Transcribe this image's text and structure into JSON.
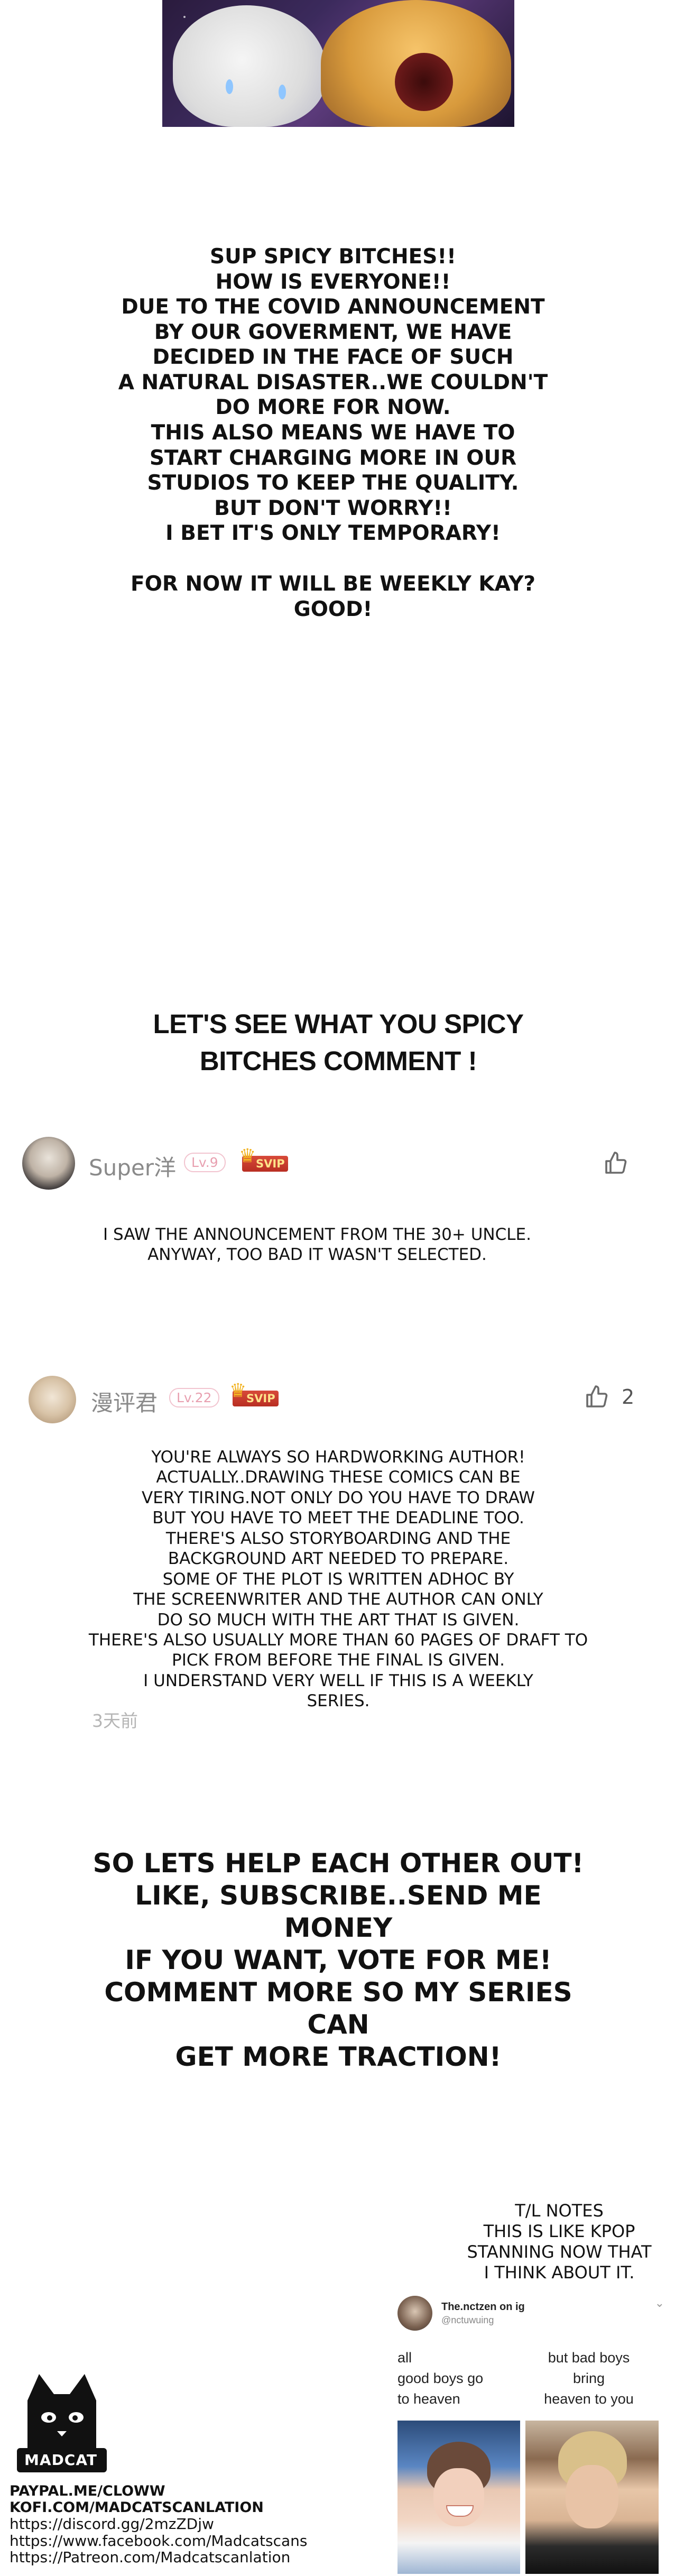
{
  "top_message": {
    "lines": [
      "SUP SPICY BITCHES!!",
      "HOW IS EVERYONE!!",
      "DUE TO THE COVID ANNOUNCEMENT",
      "BY OUR GOVERMENT, WE HAVE",
      "DECIDED IN THE FACE OF SUCH",
      "A NATURAL DISASTER..WE COULDN'T",
      "DO MORE FOR NOW.",
      "THIS ALSO MEANS WE HAVE TO",
      "START CHARGING MORE IN OUR",
      "STUDIOS TO KEEP THE QUALITY.",
      "BUT DON'T WORRY!!",
      "I BET IT'S ONLY TEMPORARY!",
      "",
      "FOR NOW IT WILL BE WEEKLY KAY?",
      "GOOD!"
    ]
  },
  "headline": {
    "line1": "LET'S SEE WHAT YOU SPICY",
    "line2": "BITCHES COMMENT !"
  },
  "comments": [
    {
      "username": "Super洋",
      "level": "Lv.9",
      "badge": "SVIP",
      "like_count": "",
      "text_lines": [
        "I SAW THE ANNOUNCEMENT FROM THE 30+ UNCLE.",
        "ANYWAY, TOO BAD IT WASN'T SELECTED."
      ],
      "date": ""
    },
    {
      "username": "漫评君",
      "level": "Lv.22",
      "badge": "SVIP",
      "like_count": "2",
      "text_lines": [
        "YOU'RE ALWAYS SO HARDWORKING AUTHOR!",
        "ACTUALLY..DRAWING THESE COMICS CAN BE",
        "VERY TIRING.NOT ONLY DO YOU HAVE TO DRAW",
        "BUT YOU HAVE TO MEET THE DEADLINE TOO.",
        "THERE'S ALSO STORYBOARDING AND THE",
        "BACKGROUND ART NEEDED TO PREPARE.",
        "SOME OF THE PLOT IS WRITTEN ADHOC BY",
        "THE SCREENWRITER AND THE AUTHOR CAN ONLY",
        "DO SO MUCH WITH THE ART THAT IS GIVEN.",
        "THERE'S ALSO USUALLY MORE THAN 60 PAGES OF DRAFT TO",
        "PICK FROM BEFORE THE FINAL IS GIVEN.",
        "I UNDERSTAND VERY WELL IF THIS IS A WEEKLY",
        "SERIES."
      ],
      "date": "3天前"
    }
  ],
  "call_to_action": {
    "lines": [
      "SO LETS HELP EACH OTHER OUT!",
      "LIKE, SUBSCRIBE..SEND ME MONEY",
      "IF YOU WANT, VOTE FOR ME!",
      "COMMENT MORE SO MY SERIES CAN",
      "GET MORE TRACTION!"
    ]
  },
  "tl_notes": {
    "lines": [
      "T/L NOTES",
      "THIS IS LIKE KPOP",
      "STANNING NOW THAT",
      "I THINK ABOUT IT."
    ]
  },
  "tweet": {
    "name": "The.nctzen on ig",
    "handle": "@nctuwuing",
    "more": "⌄",
    "left_text": [
      "all",
      "good boys go",
      "to heaven"
    ],
    "right_text": [
      "but bad boys",
      "bring",
      "heaven to you"
    ]
  },
  "credits": {
    "logo_text": "MADCAT",
    "links": [
      "PAYPAL.ME/CLOWW",
      "KOFI.COM/MADCATSCANLATION",
      "https://discord.gg/2mzZDjw",
      "https://www.facebook.com/Madcatscans",
      "https://Patreon.com/Madcatscanlation"
    ]
  },
  "icons": {
    "like": "thumbs-up-icon",
    "crown": "crown-icon"
  },
  "colors": {
    "username": "#8a8a8a",
    "level_badge": "#e8a0b0",
    "svip_badge": "#c43a2c",
    "date": "#b5b5b5"
  }
}
